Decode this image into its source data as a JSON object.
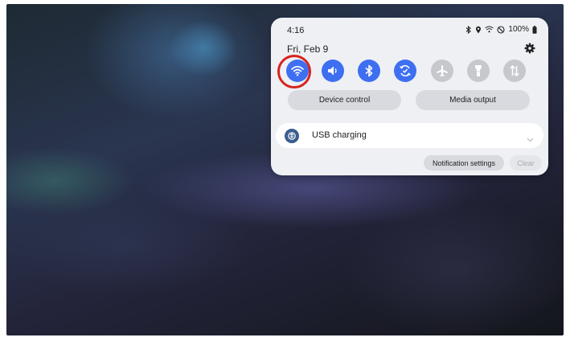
{
  "status_bar": {
    "time": "4:16",
    "battery": "100%",
    "icons": [
      "bluetooth-icon",
      "location-icon",
      "wifi-calling-icon",
      "do-not-disturb-icon",
      "battery-icon"
    ]
  },
  "date": "Fri, Feb 9",
  "quick_toggles": [
    {
      "name": "wifi",
      "icon": "wifi-icon",
      "state": "on",
      "circled": true
    },
    {
      "name": "sound",
      "icon": "sound-icon",
      "state": "on"
    },
    {
      "name": "bluetooth",
      "icon": "bluetooth-icon",
      "state": "on"
    },
    {
      "name": "auto-rotate",
      "icon": "auto-rotate-icon",
      "state": "on"
    },
    {
      "name": "airplane-mode",
      "icon": "airplane-icon",
      "state": "off"
    },
    {
      "name": "flashlight",
      "icon": "flashlight-icon",
      "state": "off"
    },
    {
      "name": "mobile-data",
      "icon": "mobile-data-icon",
      "state": "off"
    }
  ],
  "buttons": {
    "device_control": "Device control",
    "media_output": "Media output"
  },
  "notification": {
    "title": "USB charging",
    "icon": "usb-icon"
  },
  "notification_actions": {
    "settings": "Notification settings",
    "clear": "Clear"
  },
  "colors": {
    "toggle_on": "#3e6ff1",
    "toggle_off": "#c6c8cd",
    "highlight_ring": "#d6241d",
    "panel": "#eef0f4"
  }
}
